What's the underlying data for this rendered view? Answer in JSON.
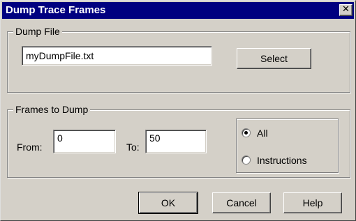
{
  "window": {
    "title": "Dump Trace Frames",
    "close_glyph": "✕"
  },
  "dump_file": {
    "legend": "Dump File",
    "value": "myDumpFile.txt",
    "select_label": "Select"
  },
  "frames": {
    "legend": "Frames to Dump",
    "from_label": "From:",
    "from_value": "0",
    "to_label": "To:",
    "to_value": "50",
    "options": [
      {
        "label": "All",
        "selected": true
      },
      {
        "label": "Instructions",
        "selected": false
      }
    ]
  },
  "buttons": {
    "ok": "OK",
    "cancel": "Cancel",
    "help": "Help"
  }
}
